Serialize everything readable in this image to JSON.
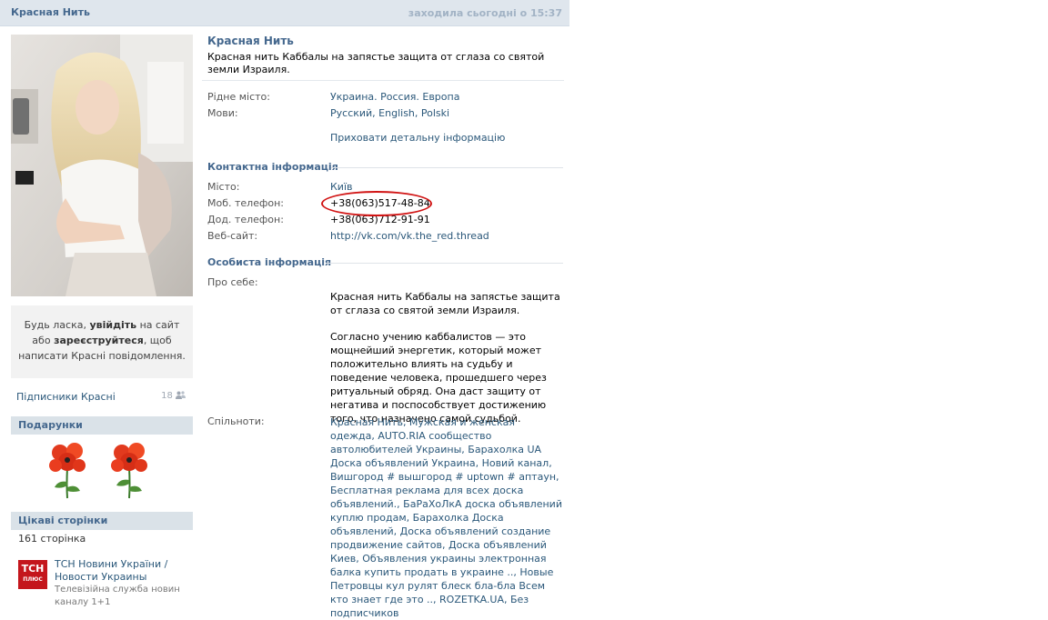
{
  "header": {
    "profile_name": "Красная Нить",
    "last_seen": "заходила сьогодні о 15:37"
  },
  "sidebar": {
    "message_box": {
      "prefix": "Будь ласка, ",
      "login_link": "увійдіть",
      "middle": " на сайт або ",
      "register_link": "зареєструйтеся",
      "suffix": ", щоб написати Красні повідомлення."
    },
    "subscribers": {
      "label": "Підписники Красні",
      "count": "18"
    },
    "gifts": {
      "title": "Подарунки"
    },
    "pages": {
      "title": "Цікаві сторінки",
      "count": "161 сторінка",
      "items": [
        {
          "logo_text": "ТСН",
          "logo_sub": "ПЛЮС",
          "title": "ТСН Новини України / Новости Украины",
          "description": "Телевізійна служба новин каналу 1+1"
        }
      ]
    }
  },
  "profile": {
    "name": "Красная Нить",
    "status": "Красная нить Каббалы на запястье защита от сглаза со святой земли Израиля.",
    "hometown": {
      "label": "Рідне місто:",
      "value": "Украина. Россия. Европа"
    },
    "languages": {
      "label": "Мови:",
      "value": "Русский, English, Polski"
    },
    "hide_details": "Приховати детальну інформацію",
    "contacts": {
      "title": "Контактна інформація",
      "city": {
        "label": "Місто:",
        "value": "Київ"
      },
      "mobile": {
        "label": "Моб. телефон:",
        "value": "+38(063)517-48-84"
      },
      "extra_phone": {
        "label": "Дод. телефон:",
        "value": "+38(063)712-91-91"
      },
      "website": {
        "label": "Веб-сайт:",
        "value": "http://vk.com/vk.the_red.thread"
      }
    },
    "personal": {
      "title": "Особиста інформація",
      "about": {
        "label": "Про себе:",
        "p1": "Красная нить Каббалы на запястье защита от сглаза со святой земли Израиля.",
        "p2": "Согласно учению каббалистов — это мощнейший энергетик, который может положительно влиять на судьбу и поведение человека, прошедшего через ритуальный обряд. Она даст защиту от негатива и поспособствует достижению того, что назначено самой судьбой."
      },
      "communities": {
        "label": "Спільноти:",
        "value": "Красная Нить, Мужская и женская одежда, AUTO.RIA сообщество автолюбителей Украины, Барахолка UA Доска объявлений Украина, Новий канал, Вишгород # вышгород # uptown # аптаун, Бесплатная реклама для всех доска объявлений., БаРаХоЛкА доска объявлений куплю продам, Барахолка Доска объявлений, Доска объявлений создание продвижение сайтов, Доска объявлений Киев, Объявления украины электронная балка купить продать в украине .., Новые Петровцы кул рулят блеск бла-бла Всем кто знает где это .., ROZETKA.UA, Без подписчиков"
      }
    }
  },
  "colors": {
    "link": "#2b587a",
    "heading": "#45688e",
    "topbar": "#dfe6ed",
    "highlight_circle": "#d11414"
  }
}
